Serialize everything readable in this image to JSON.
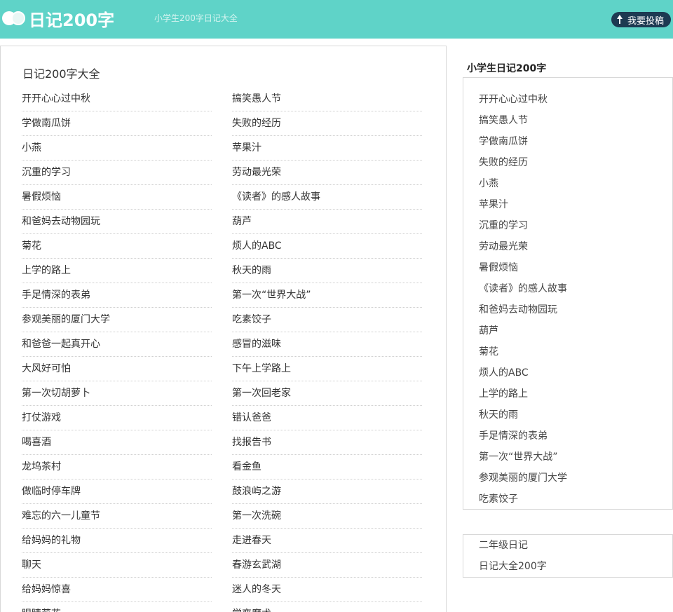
{
  "header": {
    "logo_text": "日记200字",
    "tagline": "小学生200字日记大全",
    "submit_label": "我要投稿",
    "bg_color": "#5fd3c8"
  },
  "main": {
    "title": "日记200字大全",
    "left_items": [
      "开开心心过中秋",
      "学做南瓜饼",
      "小燕",
      "沉重的学习",
      "暑假烦恼",
      "和爸妈去动物园玩",
      "菊花",
      "上学的路上",
      "手足情深的表弟",
      "参观美丽的厦门大学",
      "和爸爸一起真开心",
      "大风好可怕",
      "第一次切胡萝卜",
      "打仗游戏",
      "喝喜酒",
      "龙坞茶村",
      "做临时停车牌",
      "难忘的六一儿童节",
      "给妈妈的礼物",
      "聊天",
      "给妈妈惊喜",
      "眼睛菜花"
    ],
    "right_items": [
      "搞笑愚人节",
      "失败的经历",
      "苹果汁",
      "劳动最光荣",
      "《读者》的感人故事",
      "葫芦",
      "烦人的ABC",
      "秋天的雨",
      "第一次“世界大战”",
      "吃素饺子",
      "感冒的滋味",
      "下午上学路上",
      "第一次回老家",
      "错认爸爸",
      "找报告书",
      "看金鱼",
      "鼓浪屿之游",
      "第一次洗碗",
      "走进春天",
      "春游玄武湖",
      "迷人的冬天",
      "学变魔术"
    ]
  },
  "sidebar": {
    "title": "小学生日记200字",
    "items": [
      "开开心心过中秋",
      "搞笑愚人节",
      "学做南瓜饼",
      "失败的经历",
      "小燕",
      "苹果汁",
      "沉重的学习",
      "劳动最光荣",
      "暑假烦恼",
      "《读者》的感人故事",
      "和爸妈去动物园玩",
      "葫芦",
      "菊花",
      "烦人的ABC",
      "上学的路上",
      "秋天的雨",
      "手足情深的表弟",
      "第一次“世界大战”",
      "参观美丽的厦门大学",
      "吃素饺子"
    ],
    "links": [
      "二年级日记",
      "日记大全200字"
    ]
  }
}
